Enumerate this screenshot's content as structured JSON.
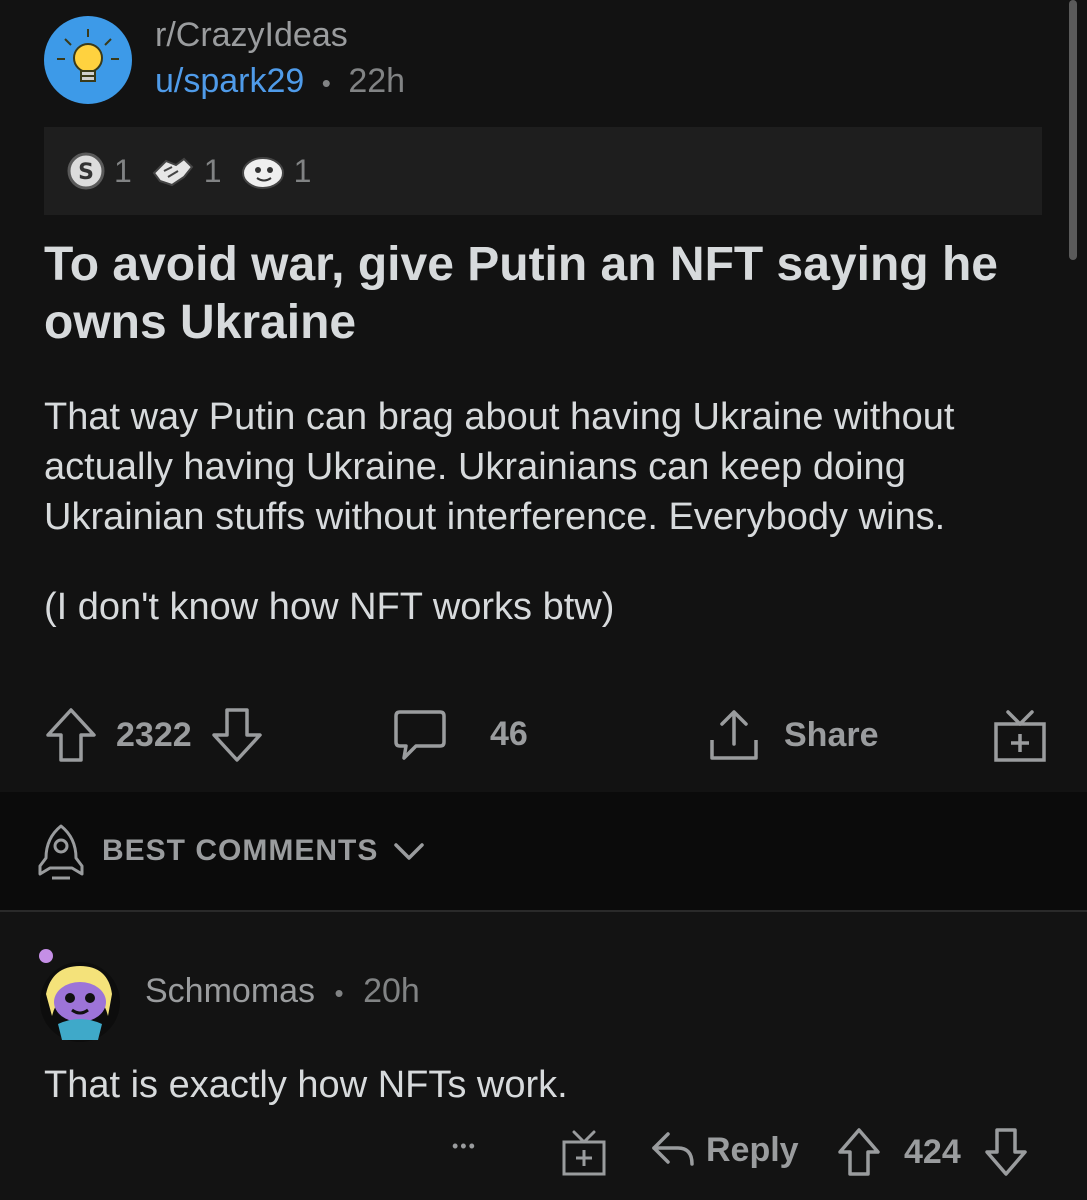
{
  "post": {
    "subreddit": "r/CrazyIdeas",
    "author": "u/spark29",
    "separator": "•",
    "age": "22h",
    "awards": [
      {
        "icon": "silver-award-icon",
        "count": "1"
      },
      {
        "icon": "helpful-award-icon",
        "count": "1"
      },
      {
        "icon": "wholesome-award-icon",
        "count": "1"
      }
    ],
    "title": "To avoid war, give Putin an NFT saying he owns Ukraine",
    "body": [
      "That way Putin can brag about having Ukraine without actually having Ukraine. Ukrainians can keep doing Ukrainian stuffs without interference. Everybody wins.",
      "(I don't know how NFT works btw)"
    ],
    "votes": "2322",
    "comments": "46",
    "share_label": "Share"
  },
  "sort": {
    "label": "BEST COMMENTS"
  },
  "comment": {
    "author": "Schmomas",
    "separator": "•",
    "age": "20h",
    "text": "That is exactly how NFTs work.",
    "more": "•••",
    "reply_label": "Reply",
    "votes": "424"
  },
  "colors": {
    "background": "#121212",
    "username_link": "#4f9be9",
    "subreddit_avatar": "#3d9ae8",
    "muted_text": "#9a9c9e"
  }
}
